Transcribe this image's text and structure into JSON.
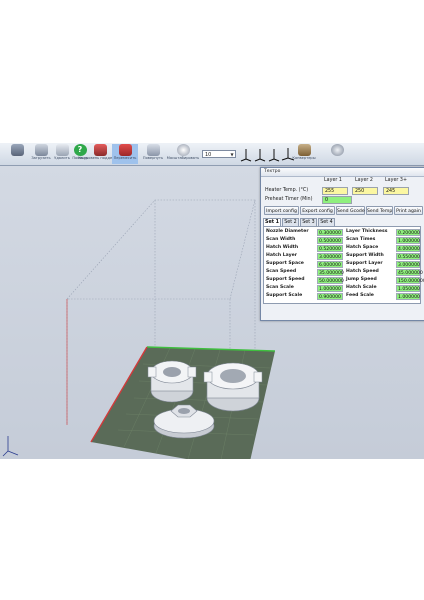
{
  "toolbar": {
    "items": [
      {
        "label": "",
        "icon": "printer-icon"
      },
      {
        "label": "Загрузить",
        "icon": "open-icon"
      },
      {
        "label": "Удалить",
        "icon": "delete-icon"
      },
      {
        "label": "Помощь",
        "icon": "help-icon"
      },
      {
        "label": "На уровень поддержки",
        "icon": "support-icon"
      },
      {
        "label": "Перемесить",
        "icon": "move-icon"
      },
      {
        "label": "Повернуть",
        "icon": "rotate-icon"
      },
      {
        "label": "Масштабировать",
        "icon": "scale-icon"
      },
      {
        "label": "",
        "icon": "axis-x-icon"
      },
      {
        "label": "",
        "icon": "axis-y-icon"
      },
      {
        "label": "",
        "icon": "axis-z-icon"
      },
      {
        "label": "",
        "icon": "axis-all-icon"
      },
      {
        "label": "Конвертеры",
        "icon": "convert-icon"
      },
      {
        "label": "",
        "icon": "settings-icon"
      }
    ],
    "zoom_value": "10"
  },
  "dialog": {
    "title": "Техтро",
    "layer_headers": [
      "Layer 1",
      "Layer 2",
      "Layer 3+"
    ],
    "heater_label": "Heater Temp. (°C)",
    "heater_values": [
      "255",
      "250",
      "245"
    ],
    "preheat_label": "Preheat Timer (Min)",
    "preheat_value": "0",
    "buttons": [
      "Import config",
      "Export config",
      "Send Gcode",
      "Send Temp",
      "Print again"
    ],
    "tabs": [
      "Set 1",
      "Set 2",
      "Set 3",
      "Set 4"
    ],
    "params_left": [
      {
        "label": "Nozzle Diameter",
        "value": "0.300000"
      },
      {
        "label": "Scan Width",
        "value": "0.500000"
      },
      {
        "label": "Hatch Width",
        "value": "0.520000"
      },
      {
        "label": "Hatch Layer",
        "value": "3.000000"
      },
      {
        "label": "Support Space",
        "value": "6.000000"
      },
      {
        "label": "Scan Speed",
        "value": "35.000000"
      },
      {
        "label": "Support Speed",
        "value": "50.000000"
      },
      {
        "label": "Scan Scale",
        "value": "1.000000"
      },
      {
        "label": "Support Scale",
        "value": "0.900000"
      }
    ],
    "params_right": [
      {
        "label": "Layer Thickness",
        "value": "0.200000"
      },
      {
        "label": "Scan Times",
        "value": "1.000000"
      },
      {
        "label": "Hatch Space",
        "value": "4.000000"
      },
      {
        "label": "Support Width",
        "value": "0.550000"
      },
      {
        "label": "Support Layer",
        "value": "3.000000"
      },
      {
        "label": "Hatch Speed",
        "value": "45.000000"
      },
      {
        "label": "Jump Speed",
        "value": "150.000000"
      },
      {
        "label": "Hatch Scale",
        "value": "1.050000"
      },
      {
        "label": "Feed Scale",
        "value": "1.000000"
      }
    ]
  },
  "colors": {
    "platform": "#5a6b58",
    "grid_green": "#3fbf3f",
    "grid_red": "#d13a3a",
    "field_green": "#8ff07e",
    "field_yellow": "#fbf7a2"
  }
}
